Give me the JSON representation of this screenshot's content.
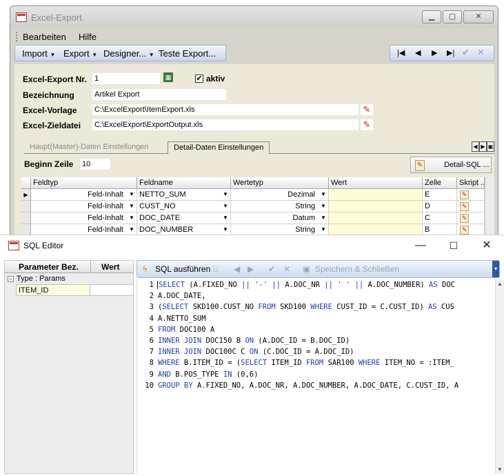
{
  "win1": {
    "title": "Excel-Export",
    "menu": {
      "edit": "Bearbeiten",
      "help": "Hilfe"
    },
    "toolbar": {
      "import": "Import",
      "export": "Export",
      "designer": "Designer...",
      "test": "Teste Export..."
    },
    "fields": {
      "nr_label": "Excel-Export Nr.",
      "nr_value": "1",
      "aktiv_label": "aktiv",
      "aktiv_checked": "✔",
      "bez_label": "Bezeichnung",
      "bez_value": "Artikel Export",
      "vorlage_label": "Excel-Vorlage",
      "vorlage_value": "C:\\ExcelExport\\ItemExport.xls",
      "ziel_label": "Excel-Zieldatei",
      "ziel_value": "C:\\ExcelExport\\ExportOutput.xls"
    },
    "tabs": {
      "master": "Haupt(Master)-Daten Einstellungen",
      "detail": "Detail-Daten Einstellungen"
    },
    "beginn_label": "Beginn Zeile",
    "beginn_value": "10",
    "detail_sql_button": "Detail-SQL ...",
    "grid": {
      "headers": [
        "Feldtyp",
        "Feldname",
        "Wertetyp",
        "Wert",
        "Zelle",
        "Skript ..."
      ],
      "rows": [
        {
          "feldtyp": "Feld-Inhalt",
          "feldname": "NETTO_SUM",
          "wertetyp": "Dezimal",
          "wert": "",
          "zelle": "E"
        },
        {
          "feldtyp": "Feld-Inhalt",
          "feldname": "CUST_NO",
          "wertetyp": "String",
          "wert": "",
          "zelle": "D"
        },
        {
          "feldtyp": "Feld-Inhalt",
          "feldname": "DOC_DATE",
          "wertetyp": "Datum",
          "wert": "",
          "zelle": "C"
        },
        {
          "feldtyp": "Feld-Inhalt",
          "feldname": "DOC_NUMBER",
          "wertetyp": "String",
          "wert": "",
          "zelle": "B"
        }
      ]
    }
  },
  "win2": {
    "title": "SQL Editor",
    "params": {
      "col_name": "Parameter Bez.",
      "col_value": "Wert",
      "group": "Type : Params",
      "rows": [
        {
          "name": "ITEM_ID",
          "value": ""
        }
      ]
    },
    "toolbar": {
      "run": "SQL ausführen",
      "save_close": "Speichern & Schließen"
    },
    "code": [
      {
        "n": "1",
        "parts": [
          [
            "kw",
            "SELECT"
          ],
          [
            "t",
            " (A.FIXED_NO "
          ],
          [
            "kw",
            "||"
          ],
          [
            "t",
            " "
          ],
          [
            "str",
            "'-'"
          ],
          [
            "t",
            " "
          ],
          [
            "kw",
            "||"
          ],
          [
            "t",
            " A.DOC_NR "
          ],
          [
            "kw",
            "||"
          ],
          [
            "t",
            " "
          ],
          [
            "str",
            "' '"
          ],
          [
            "t",
            " "
          ],
          [
            "kw",
            "||"
          ],
          [
            "t",
            " A.DOC_NUMBER) "
          ],
          [
            "kw",
            "AS"
          ],
          [
            "t",
            " DOC"
          ]
        ]
      },
      {
        "n": "2",
        "parts": [
          [
            "t",
            "A.DOC_DATE,"
          ]
        ]
      },
      {
        "n": "3",
        "parts": [
          [
            "t",
            "("
          ],
          [
            "kw",
            "SELECT"
          ],
          [
            "t",
            " SKD100.CUST_NO "
          ],
          [
            "kw",
            "FROM"
          ],
          [
            "t",
            " SKD100 "
          ],
          [
            "kw",
            "WHERE"
          ],
          [
            "t",
            " CUST_ID = C.CUST_ID) "
          ],
          [
            "kw",
            "AS"
          ],
          [
            "t",
            " CUS"
          ]
        ]
      },
      {
        "n": "4",
        "parts": [
          [
            "t",
            "A.NETTO_SUM"
          ]
        ]
      },
      {
        "n": "5",
        "parts": [
          [
            "kw",
            "FROM"
          ],
          [
            "t",
            " DOC100 A"
          ]
        ]
      },
      {
        "n": "6",
        "parts": [
          [
            "kw",
            "INNER JOIN"
          ],
          [
            "t",
            " DOC150 B "
          ],
          [
            "kw",
            "ON"
          ],
          [
            "t",
            " (A.DOC_ID = B.DOC_ID)"
          ]
        ]
      },
      {
        "n": "7",
        "parts": [
          [
            "kw",
            "INNER JOIN"
          ],
          [
            "t",
            " DOC100C C "
          ],
          [
            "kw",
            "ON"
          ],
          [
            "t",
            " (C.DOC_ID = A.DOC_ID)"
          ]
        ]
      },
      {
        "n": "8",
        "parts": [
          [
            "kw",
            "WHERE"
          ],
          [
            "t",
            " B.ITEM_ID = ("
          ],
          [
            "kw",
            "SELECT"
          ],
          [
            "t",
            " ITEM_ID "
          ],
          [
            "kw",
            "FROM"
          ],
          [
            "t",
            " SAR100 "
          ],
          [
            "kw",
            "WHERE"
          ],
          [
            "t",
            " ITEM_NO = :ITEM_"
          ]
        ]
      },
      {
        "n": "9",
        "parts": [
          [
            "kw",
            "AND"
          ],
          [
            "t",
            " B.POS_TYPE "
          ],
          [
            "kw",
            "IN"
          ],
          [
            "t",
            " (0,6)"
          ]
        ]
      },
      {
        "n": "10",
        "parts": [
          [
            "kw",
            "GROUP BY"
          ],
          [
            "t",
            " A.FIXED_NO, A.DOC_NR, A.DOC_NUMBER, A.DOC_DATE, C.CUST_ID, A"
          ]
        ]
      }
    ]
  }
}
